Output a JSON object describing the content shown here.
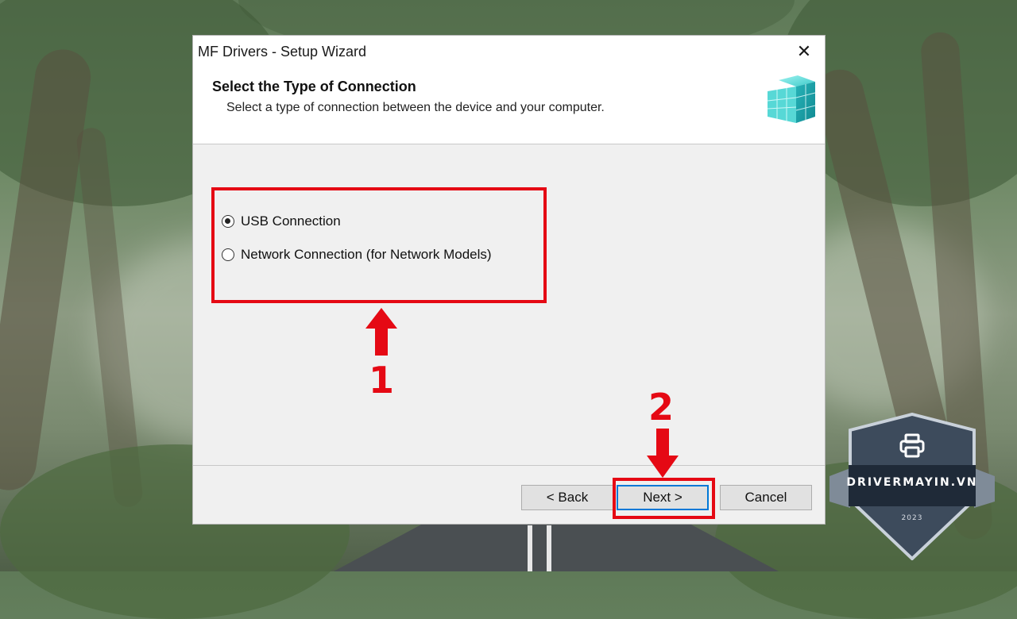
{
  "window": {
    "title": "MF Drivers - Setup Wizard",
    "close_glyph": "✕"
  },
  "header": {
    "title": "Select the Type of Connection",
    "subtitle": "Select a type of connection between the device and your computer.",
    "icon": "setup-cubes-icon"
  },
  "options": [
    {
      "label": "USB Connection",
      "selected": true
    },
    {
      "label": "Network Connection (for Network Models)",
      "selected": false
    }
  ],
  "buttons": {
    "back": "< Back",
    "next": "Next >",
    "cancel": "Cancel"
  },
  "annotations": {
    "step1": "1",
    "step2": "2",
    "color": "#e50914"
  },
  "watermark": {
    "brand": "DRIVERMAYIN.VN",
    "year": "2023",
    "icon": "printer-icon"
  },
  "colors": {
    "dialog_bg": "#f0f0f0",
    "accent_focus": "#0078d7",
    "badge_fill": "#3d4b5c"
  }
}
